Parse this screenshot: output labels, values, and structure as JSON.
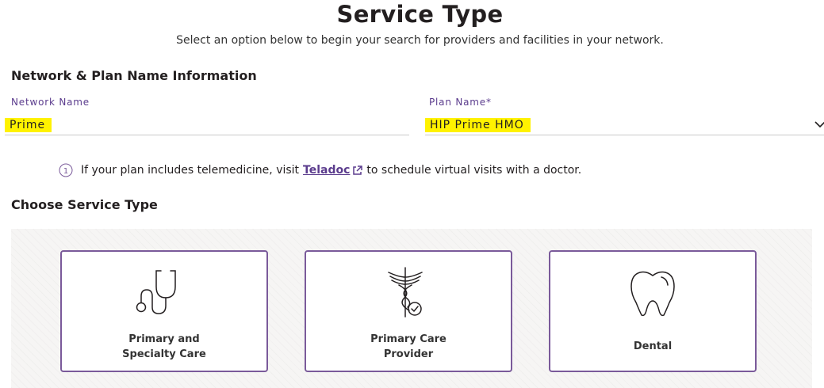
{
  "header": {
    "title": "Service Type",
    "subtitle": "Select an option below to begin your search for providers and facilities in your network."
  },
  "network_section": {
    "heading": "Network & Plan Name Information",
    "network_label": "Network Name",
    "network_value": "Prime",
    "plan_label": "Plan Name*",
    "plan_value": "HIP Prime HMO"
  },
  "telemedicine": {
    "text_before": "If your plan includes telemedicine, visit",
    "link_text": "Teladoc",
    "text_after": "to schedule virtual visits with a doctor."
  },
  "service_section": {
    "heading": "Choose Service Type",
    "cards": [
      {
        "label": "Primary and\nSpecialty Care",
        "icon": "stethoscope-icon"
      },
      {
        "label": "Primary Care\nProvider",
        "icon": "caduceus-check-icon"
      },
      {
        "label": "Dental",
        "icon": "tooth-icon"
      }
    ]
  },
  "colors": {
    "accent_purple": "#5b3c8d",
    "card_border": "#7a5a9a",
    "highlight": "#fff200"
  }
}
